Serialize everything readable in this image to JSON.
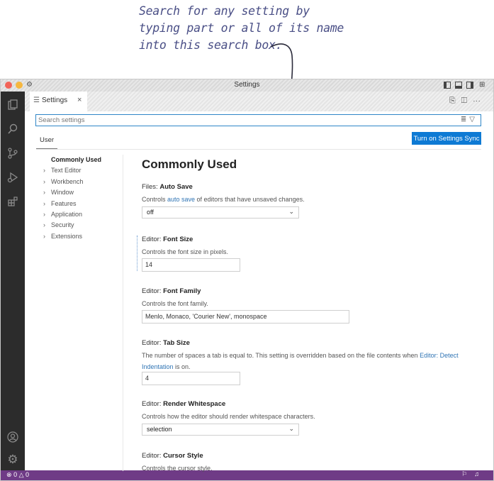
{
  "annotation": {
    "lines": [
      "Search for any setting by",
      "typing part or all of its name",
      "into this search box."
    ]
  },
  "window": {
    "title": "Settings"
  },
  "activity_icons": [
    "explorer-icon",
    "search-icon",
    "source-control-icon",
    "run-debug-icon",
    "extensions-icon",
    "accounts-icon",
    "manage-gear-icon"
  ],
  "tab": {
    "label": "Settings",
    "close": "×"
  },
  "search": {
    "placeholder": "Search settings"
  },
  "scope_tab": "User",
  "sync_button": "Turn on Settings Sync",
  "toc": {
    "active": "Commonly Used",
    "items": [
      "Text Editor",
      "Workbench",
      "Window",
      "Features",
      "Application",
      "Security",
      "Extensions"
    ]
  },
  "main": {
    "heading": "Commonly Used",
    "settings": [
      {
        "category": "Files: ",
        "name": "Auto Save",
        "desc_before": "Controls ",
        "desc_link": "auto save",
        "desc_after": " of editors that have unsaved changes.",
        "value": "off"
      },
      {
        "category": "Editor: ",
        "name": "Font Size",
        "desc": "Controls the font size in pixels.",
        "value": "14"
      },
      {
        "category": "Editor: ",
        "name": "Font Family",
        "desc": "Controls the font family.",
        "value": "Menlo, Monaco, 'Courier New', monospace"
      },
      {
        "category": "Editor: ",
        "name": "Tab Size",
        "desc_before": "The number of spaces a tab is equal to. This setting is overridden based on the file contents when ",
        "desc_link": "Editor: Detect Indentation",
        "desc_after": " is on.",
        "value": "4"
      },
      {
        "category": "Editor: ",
        "name": "Render Whitespace",
        "desc": "Controls how the editor should render whitespace characters.",
        "value": "selection"
      },
      {
        "category": "Editor: ",
        "name": "Cursor Style",
        "desc": "Controls the cursor style."
      }
    ]
  },
  "statusbar": {
    "errors": "0",
    "warnings": "0"
  },
  "colors": {
    "accent": "#0e7ad4",
    "statusbar": "#6f3b86",
    "activitybar": "#2c2c2c",
    "annotation": "#4a4f86"
  }
}
